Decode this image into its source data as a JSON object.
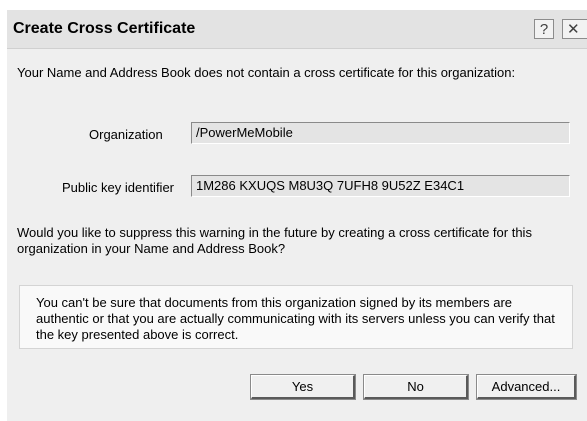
{
  "dialog": {
    "title": "Create Cross Certificate",
    "help_glyph": "?",
    "close_glyph": "✕"
  },
  "message": {
    "intro": "Your Name and Address Book does not contain a cross certificate for this organization:",
    "question": "Would you like to suppress this warning in the future by creating a cross certificate for this organization in your Name and Address Book?",
    "notice": "You can't be sure that documents from this organization signed by its members are authentic or that you are actually communicating with its servers unless you can verify that the key presented above is correct."
  },
  "fields": {
    "organization_label": "Organization",
    "organization_value": "/PowerMeMobile",
    "public_key_label": "Public key identifier",
    "public_key_value": "1M286 KXUQS M8U3Q 7UFH8 9U52Z E34C1"
  },
  "buttons": {
    "yes": "Yes",
    "no": "No",
    "advanced": "Advanced..."
  }
}
